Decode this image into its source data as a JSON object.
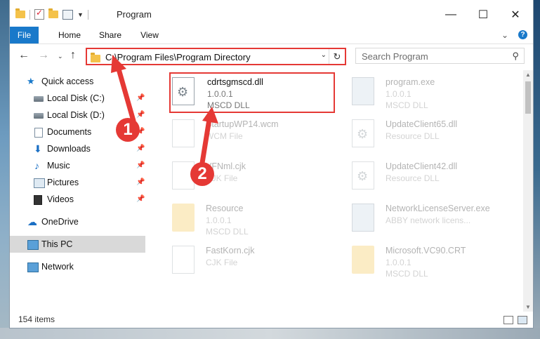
{
  "window": {
    "title": "Program",
    "controls": [
      "minimize-icon",
      "maximize-icon",
      "close-icon"
    ]
  },
  "ribbon": {
    "tabs": [
      "File",
      "Home",
      "Share",
      "View"
    ]
  },
  "address": {
    "path": "C:\\Program Files\\Program Directory",
    "search_placeholder": "Search Program"
  },
  "sidebar": {
    "items": [
      {
        "label": "Quick access",
        "icon": "star-icon"
      },
      {
        "label": "Local Disk (C:)",
        "icon": "disk-icon",
        "pinned": true
      },
      {
        "label": "Local Disk (D:)",
        "icon": "disk-icon",
        "pinned": true
      },
      {
        "label": "Documents",
        "icon": "documents-icon",
        "pinned": true
      },
      {
        "label": "Downloads",
        "icon": "download-icon",
        "pinned": true
      },
      {
        "label": "Music",
        "icon": "music-icon",
        "pinned": true
      },
      {
        "label": "Pictures",
        "icon": "pictures-icon",
        "pinned": true
      },
      {
        "label": "Videos",
        "icon": "videos-icon",
        "pinned": true
      },
      {
        "label": "OneDrive",
        "icon": "cloud-icon"
      },
      {
        "label": "This PC",
        "icon": "computer-icon",
        "selected": true
      },
      {
        "label": "Network",
        "icon": "network-icon"
      }
    ]
  },
  "files": [
    {
      "name": "cdrtsgmscd.dll",
      "line1": "1.0.0.1",
      "line2": "MSCD DLL",
      "highlighted": true
    },
    {
      "name": "program.exe",
      "line1": "1.0.0.1",
      "line2": "MSCD DLL"
    },
    {
      "name": "StartupWP14.wcm",
      "line1": "WCM File",
      "line2": ""
    },
    {
      "name": "UpdateClient65.dll",
      "line1": "Resource DLL",
      "line2": ""
    },
    {
      "name": "VFNml.cjk",
      "line1": "CJK File",
      "line2": ""
    },
    {
      "name": "UpdateClient42.dll",
      "line1": "Resource DLL",
      "line2": ""
    },
    {
      "name": "Resource",
      "line1": "1.0.0.1",
      "line2": "MSCD DLL"
    },
    {
      "name": "NetworkLicenseServer.exe",
      "line1": "ABBY network licens...",
      "line2": ""
    },
    {
      "name": "FastKorn.cjk",
      "line1": "CJK File",
      "line2": ""
    },
    {
      "name": "Microsoft.VC90.CRT",
      "line1": "1.0.0.1",
      "line2": "MSCD DLL"
    }
  ],
  "status": {
    "count": "154 items"
  },
  "annotations": {
    "step1": "1",
    "step2": "2"
  },
  "colors": {
    "accent": "#1979ca",
    "highlight": "#e53935"
  }
}
